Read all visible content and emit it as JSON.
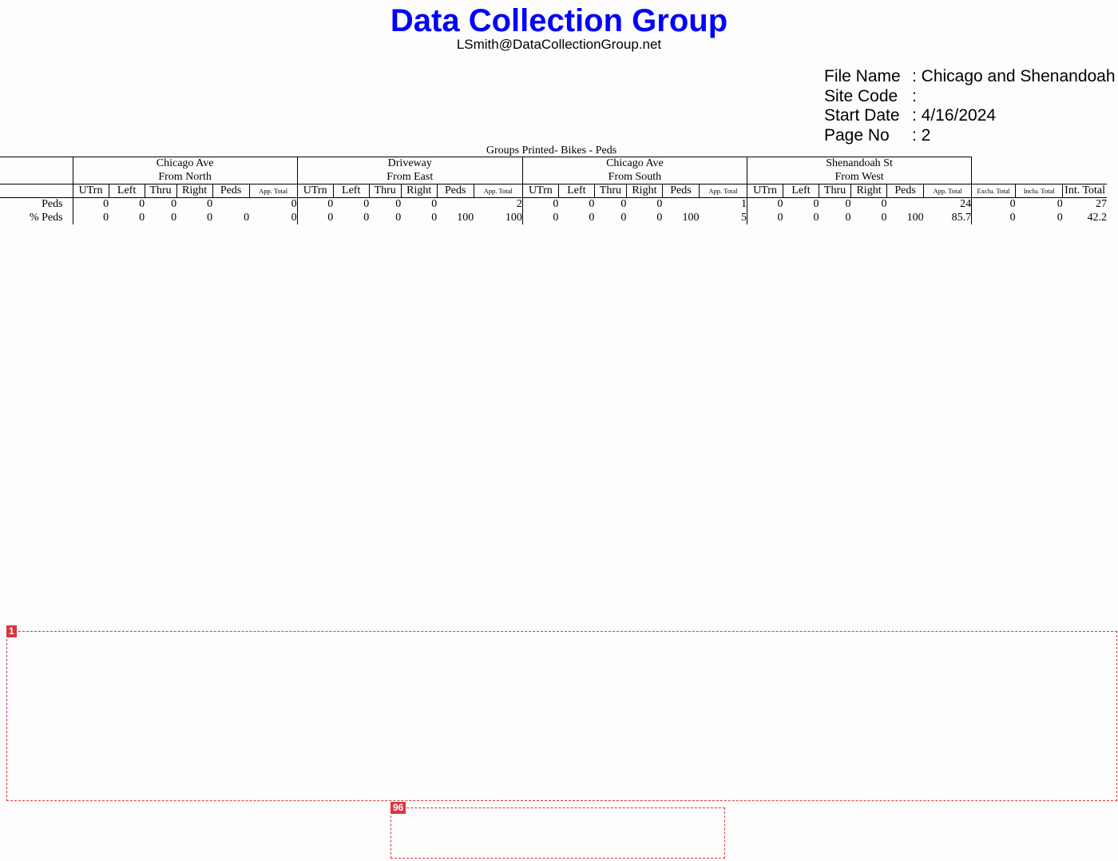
{
  "header": {
    "title": "Data Collection Group",
    "email": "LSmith@DataCollectionGroup.net"
  },
  "info": [
    {
      "label": "File Name",
      "value": ": Chicago and Shenandoah"
    },
    {
      "label": "Site Code",
      "value": ":"
    },
    {
      "label": "Start Date",
      "value": ": 4/16/2024"
    },
    {
      "label": "Page No",
      "value": ": 2"
    }
  ],
  "groups_printed": "Groups Printed- Bikes - Peds",
  "approaches": [
    {
      "name": "Chicago Ave",
      "direction": "From North"
    },
    {
      "name": "Driveway",
      "direction": "From East"
    },
    {
      "name": "Chicago Ave",
      "direction": "From South"
    },
    {
      "name": "Shenandoah St",
      "direction": "From West"
    }
  ],
  "columns": {
    "approach": [
      "UTrn",
      "Left",
      "Thru",
      "Right",
      "Peds",
      "App. Total"
    ],
    "totals": [
      "Exclu. Total",
      "Inclu. Total",
      "Int. Total"
    ]
  },
  "rows": [
    {
      "label": "Peds",
      "cells": [
        "0",
        "0",
        "0",
        "0",
        "",
        "0",
        "0",
        "0",
        "0",
        "0",
        "",
        "2",
        "0",
        "0",
        "0",
        "0",
        "",
        "1",
        "0",
        "0",
        "0",
        "0",
        "",
        "24",
        "0",
        "0",
        "27"
      ]
    },
    {
      "label": "% Peds",
      "cells": [
        "0",
        "0",
        "0",
        "0",
        "0",
        "0",
        "0",
        "0",
        "0",
        "0",
        "100",
        "100",
        "0",
        "0",
        "0",
        "0",
        "100",
        "5",
        "0",
        "0",
        "0",
        "0",
        "100",
        "85.7",
        "0",
        "0",
        "42.2"
      ]
    }
  ],
  "annotations": [
    {
      "tag": "1"
    },
    {
      "tag": "96"
    }
  ]
}
